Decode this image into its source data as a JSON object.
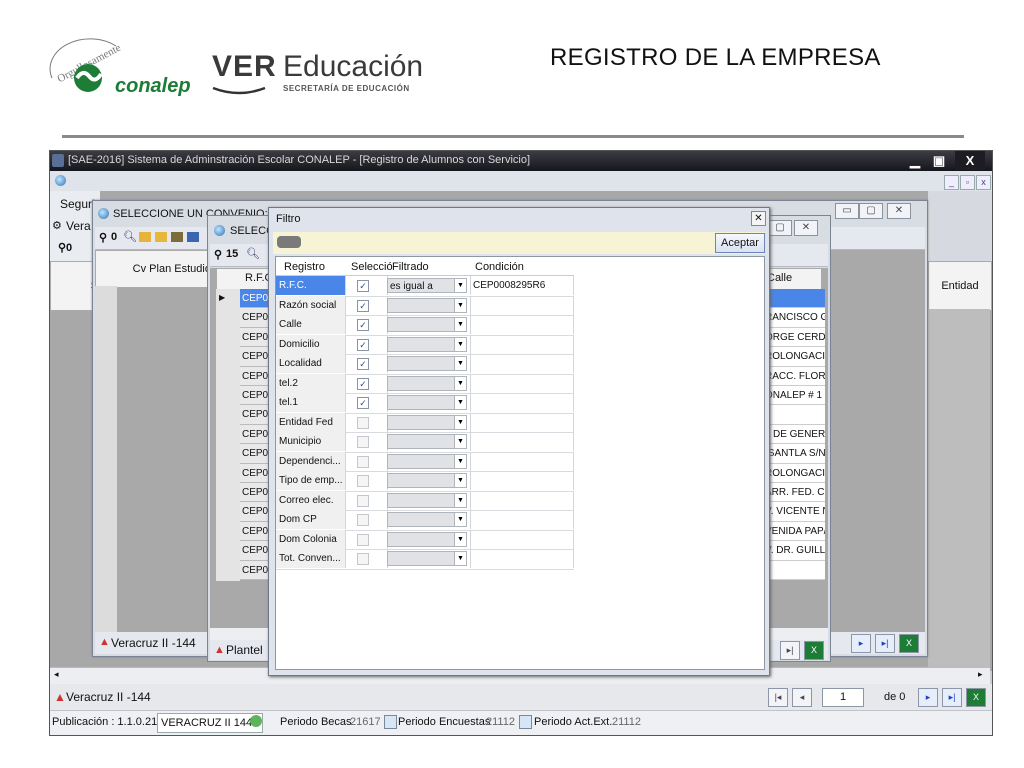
{
  "slide": {
    "title": "REGISTRO DE LA EMPRESA",
    "logo_left": {
      "top_text": "Orgullosamente",
      "brand": "conalep"
    },
    "logo_right": {
      "ver": "VER",
      "educacion": "Educación",
      "secretaria": "SECRETARÍA DE EDUCACIÓN"
    }
  },
  "main_window": {
    "title": "[SAE-2016] Sistema de Adminstración Escolar CONALEP - [Registro de Alumnos con Servicio]",
    "controls": {
      "minimize": "▁",
      "maximize": "▣",
      "close": "X"
    },
    "mdi_controls": {
      "minimize": "_",
      "restore": "▫",
      "close": "x"
    },
    "side_labels": {
      "seguridad": "Seguri",
      "veracruz": "Vera"
    },
    "column_entidad": "Entidad",
    "bottom_left": "Veracruz II -144",
    "pager": {
      "page": "1",
      "of_label": "de 0"
    }
  },
  "status_bar": {
    "publicacion": "Publicación : 1.1.0.214",
    "plantel": "VERACRUZ II 144 -",
    "periodo_becas_label": "Periodo Becas",
    "periodo_becas_value": "21617",
    "periodo_encuestas_label": "Periodo Encuestas",
    "periodo_encuestas_value": "21112",
    "periodo_actext_label": "Periodo Act.Ext.",
    "periodo_actext_value": "21112"
  },
  "convenio_window": {
    "title": "SELECCIONE UN CONVENIO:",
    "count": "0",
    "column": "Cv Plan Estudio",
    "footer": "Veracruz II -144"
  },
  "seleccion_window": {
    "title": "SELECCIO",
    "count": "15",
    "col_rfc": "R.F.C",
    "col_calle": "Calle",
    "rows_rfc": [
      "CEP0",
      "CEP0",
      "CEP0",
      "CEP0",
      "CEP0",
      "CEP0",
      "CEP0",
      "CEP0",
      "CEP0",
      "CEP0",
      "CEP0",
      "CEP0",
      "CEP0",
      "CEP0",
      "CEP0"
    ],
    "rows_calle": [
      "",
      "RANCISCO G",
      "ORGE CERD/",
      "ROLONGACI",
      "RACC. FLORI",
      "ONALEP # 1",
      "",
      "L DE GENER",
      "ISANTLA S/N",
      "ROLONGACI",
      "ARR. FED. C.",
      "V. VICENTE N",
      "VENIDA PAP/",
      "V. DR. GUILL",
      ""
    ],
    "footer": "Plantel"
  },
  "filter_dialog": {
    "title": "Filtro",
    "accept": "Aceptar",
    "headers": {
      "registro": "Registro",
      "seleccion": "Selecció",
      "filtrado": "Filtrado",
      "condicion": "Condición"
    },
    "rows": [
      {
        "registro": "R.F.C.",
        "checked": true,
        "filtrado": "es igual a",
        "condicion": "CEP0008295R6"
      },
      {
        "registro": "Razón social",
        "checked": true,
        "filtrado": "",
        "condicion": ""
      },
      {
        "registro": "Calle",
        "checked": true,
        "filtrado": "",
        "condicion": ""
      },
      {
        "registro": "Domicilio",
        "checked": true,
        "filtrado": "",
        "condicion": ""
      },
      {
        "registro": "Localidad",
        "checked": true,
        "filtrado": "",
        "condicion": ""
      },
      {
        "registro": "tel.2",
        "checked": true,
        "filtrado": "",
        "condicion": ""
      },
      {
        "registro": "tel.1",
        "checked": true,
        "filtrado": "",
        "condicion": ""
      },
      {
        "registro": "Entidad Fed",
        "checked": false,
        "filtrado": "",
        "condicion": ""
      },
      {
        "registro": "Municipio",
        "checked": false,
        "filtrado": "",
        "condicion": ""
      },
      {
        "registro": "Dependenci...",
        "checked": false,
        "filtrado": "",
        "condicion": ""
      },
      {
        "registro": "Tipo de emp...",
        "checked": false,
        "filtrado": "",
        "condicion": ""
      },
      {
        "registro": "Correo elec.",
        "checked": false,
        "filtrado": "",
        "condicion": ""
      },
      {
        "registro": "Dom CP",
        "checked": false,
        "filtrado": "",
        "condicion": ""
      },
      {
        "registro": "Dom Colonia",
        "checked": false,
        "filtrado": "",
        "condicion": ""
      },
      {
        "registro": "Tot. Conven...",
        "checked": false,
        "filtrado": "",
        "condicion": ""
      }
    ],
    "checkmark": "✓",
    "dropdown_arrow": "▼"
  },
  "colors": {
    "title_bar": "#15151c",
    "selected_row": "#4a86e8",
    "grid_gray": "#a9a9a9",
    "accent_green": "#1d7c35"
  }
}
